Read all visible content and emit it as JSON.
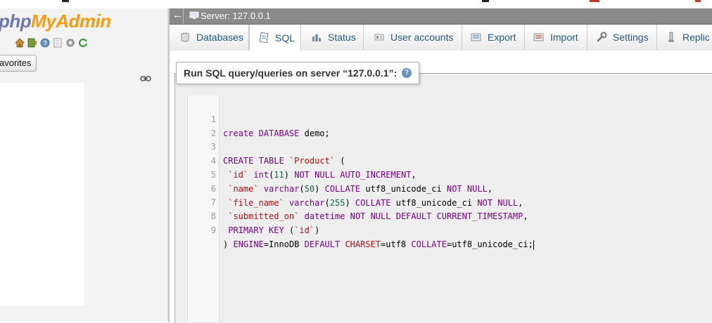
{
  "sidebar": {
    "logo_part1": "php",
    "logo_part2": "MyAdmin",
    "favorites_label": "avorites",
    "icons": [
      "home-icon",
      "exit-icon",
      "help-icon",
      "docs-icon",
      "settings-icon",
      "reload-icon"
    ]
  },
  "header": {
    "back_arrow": "←",
    "server_label": "Server: 127.0.0.1"
  },
  "tabs": [
    {
      "label": "Databases",
      "icon": "database-icon",
      "active": false
    },
    {
      "label": "SQL",
      "icon": "sql-icon",
      "active": true
    },
    {
      "label": "Status",
      "icon": "status-icon",
      "active": false
    },
    {
      "label": "User accounts",
      "icon": "users-icon",
      "active": false
    },
    {
      "label": "Export",
      "icon": "export-icon",
      "active": false
    },
    {
      "label": "Import",
      "icon": "import-icon",
      "active": false
    },
    {
      "label": "Settings",
      "icon": "wrench-icon",
      "active": false
    },
    {
      "label": "Replic",
      "icon": "replication-icon",
      "active": false
    }
  ],
  "query_panel": {
    "legend": "Run SQL query/queries on server “127.0.0.1”:"
  },
  "editor": {
    "lines": [
      {
        "n": "1",
        "code": "create DATABASE demo;"
      },
      {
        "n": "2",
        "code": ""
      },
      {
        "n": "3",
        "code": "CREATE TABLE `Product` ("
      },
      {
        "n": "4",
        "code": " `id` int(11) NOT NULL AUTO_INCREMENT,"
      },
      {
        "n": "5",
        "code": " `name` varchar(50) COLLATE utf8_unicode_ci NOT NULL,"
      },
      {
        "n": "6",
        "code": " `file_name` varchar(255) COLLATE utf8_unicode_ci NOT NULL,"
      },
      {
        "n": "7",
        "code": " `submitted_on` datetime NOT NULL DEFAULT CURRENT_TIMESTAMP,"
      },
      {
        "n": "8",
        "code": " PRIMARY KEY (`id`)"
      },
      {
        "n": "9",
        "code": ") ENGINE=InnoDB DEFAULT CHARSET=utf8 COLLATE=utf8_unicode_ci;"
      }
    ]
  },
  "colors": {
    "keyword": "#770088",
    "identifier": "#aa1111",
    "number": "#116644",
    "server_bar": "#8a8a8a",
    "tab_text": "#235a81"
  }
}
